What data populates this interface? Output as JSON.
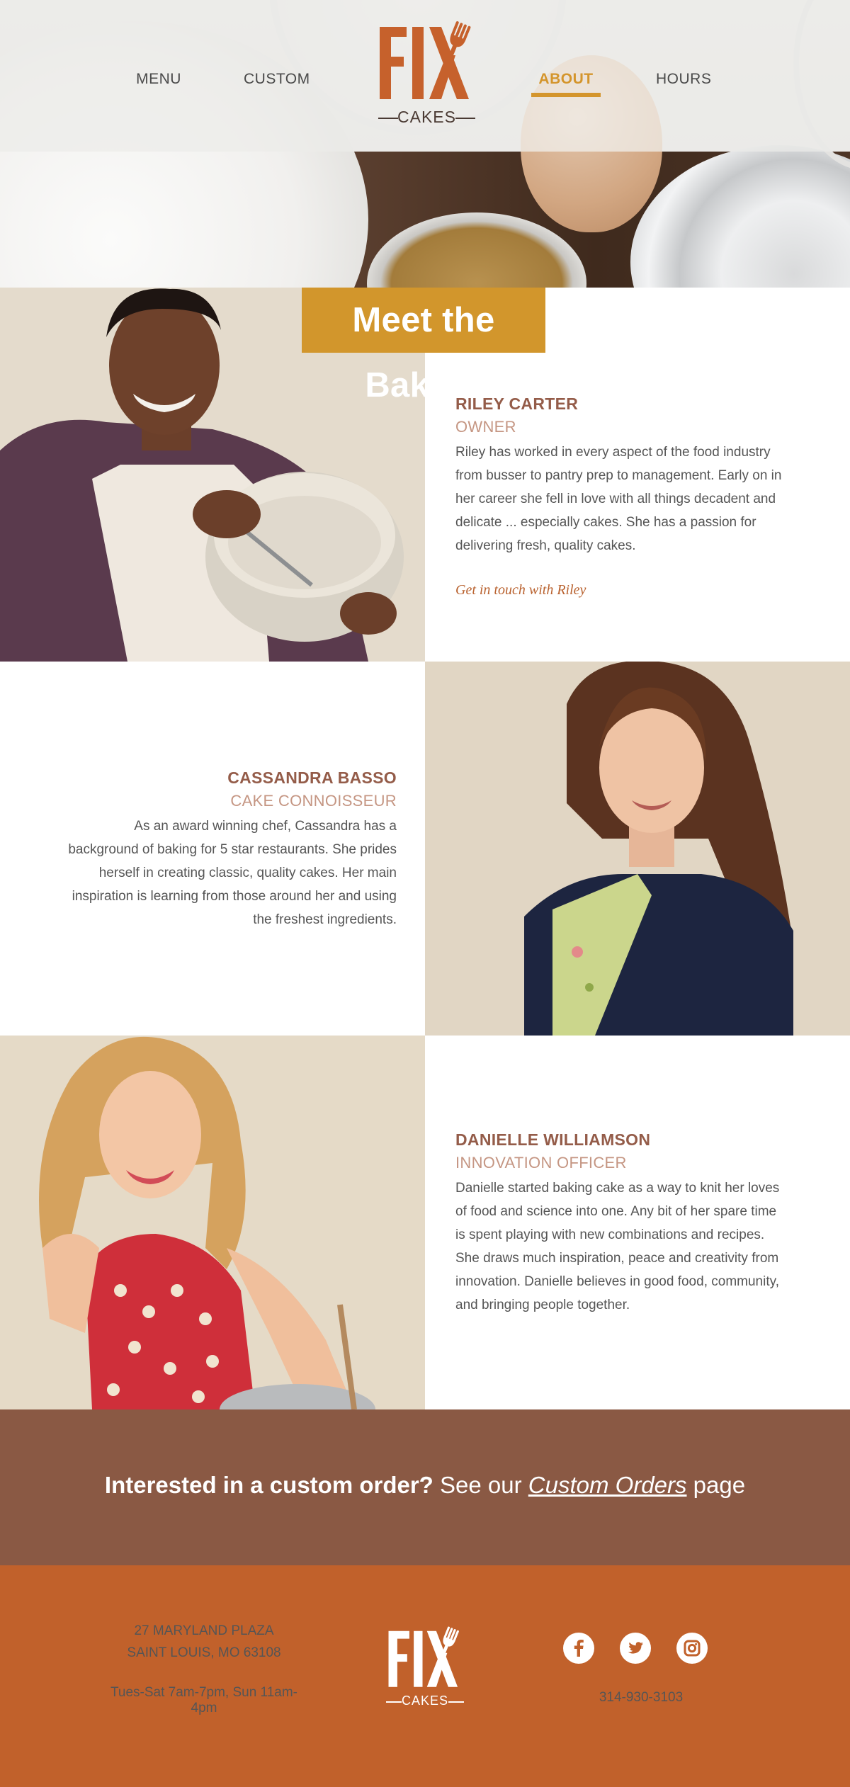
{
  "colors": {
    "accent_gold": "#d2962c",
    "name_brown": "#945c49",
    "role_rose": "#c59683",
    "link_orange": "#b9622f",
    "cta_brown": "#8a5944",
    "footer_orange": "#c1612b",
    "logo_orange": "#c6612c"
  },
  "header": {
    "nav": [
      {
        "label": "MENU"
      },
      {
        "label": "CUSTOM"
      },
      {
        "label": "ABOUT",
        "active": true
      },
      {
        "label": "HOURS"
      }
    ],
    "logo": {
      "mark": "FIX",
      "subtitle": "CAKES",
      "icon": "fork-icon"
    }
  },
  "page": {
    "title": "Meet the Bakers"
  },
  "bakers": [
    {
      "name": "RILEY CARTER",
      "role": "OWNER",
      "bio": "Riley has worked in every aspect of the food industry from busser to pantry prep to management. Early on in her career she fell in love with all things decadent and delicate ... especially cakes. She has a passion for delivering fresh, quality cakes.",
      "link": "Get in touch with Riley"
    },
    {
      "name": "CASSANDRA BASSO",
      "role": "CAKE CONNOISSEUR",
      "bio": "As an award winning chef, Cassandra has a background of baking for 5 star restaurants. She prides herself in creating classic, quality cakes. Her main inspiration is learning from those around her and using the freshest ingredients."
    },
    {
      "name": "DANIELLE WILLIAMSON",
      "role": "INNOVATION OFFICER",
      "bio": "Danielle started baking cake as a way to knit her loves of food and science into one. Any bit of her spare time is spent playing with new combinations and recipes. She draws much inspiration, peace and creativity from innovation. Danielle believes in good food, community, and bringing people together."
    }
  ],
  "cta": {
    "question": "Interested in a custom order?",
    "see_our": "See our",
    "link": "Custom Orders",
    "suffix": "page"
  },
  "footer": {
    "address_line1": "27 MARYLAND PLAZA",
    "address_line2": "SAINT LOUIS, MO 63108",
    "hours": "Tues-Sat 7am-7pm, Sun 11am-4pm",
    "phone": "314-930-3103",
    "logo": {
      "mark": "FIX",
      "subtitle": "CAKES"
    },
    "social": [
      {
        "icon": "facebook-icon"
      },
      {
        "icon": "twitter-icon"
      },
      {
        "icon": "instagram-icon"
      }
    ]
  }
}
